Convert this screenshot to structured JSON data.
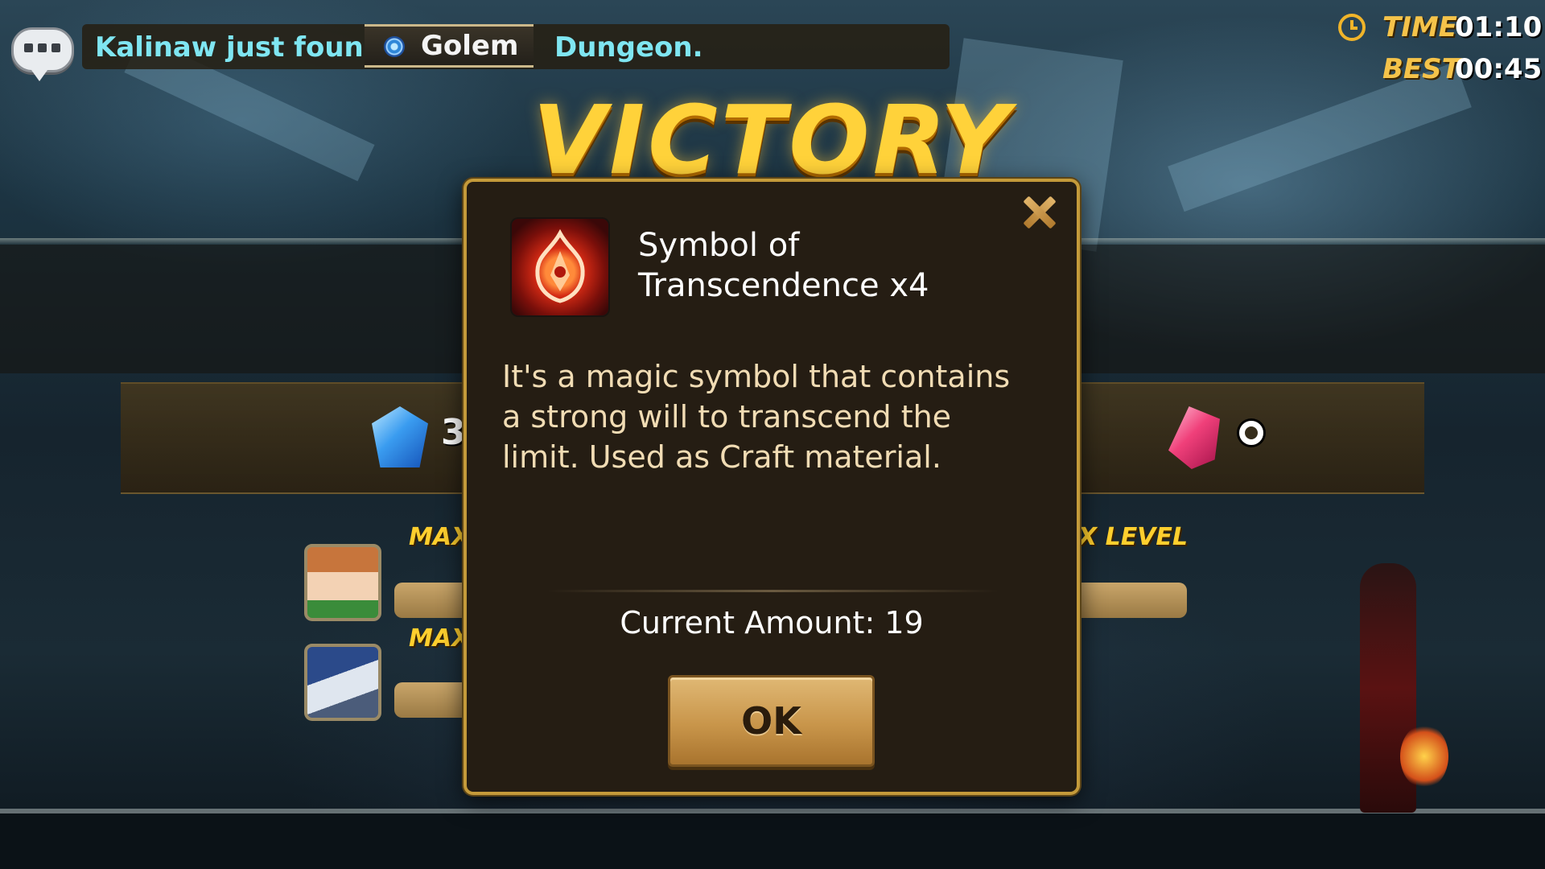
{
  "notice": {
    "prefix": "Kalinaw just found",
    "dungeon_name": "Golem",
    "suffix": "Dungeon."
  },
  "timer": {
    "time_label": "TIME",
    "time_value": "01:10",
    "best_label": "BEST",
    "best_value": "00:45"
  },
  "banner": {
    "title": "VICTORY"
  },
  "background_rewards": {
    "crystal_count_visible": "3",
    "max_label_left": "MAX",
    "max_level_right": "X LEVEL",
    "max_label_left_2": "MAX"
  },
  "modal": {
    "item_name": "Symbol of Transcendence x4",
    "description": "It's a magic symbol that contains a strong will to transcend the limit. Used as Craft material.",
    "amount_label": "Current Amount: 19",
    "ok_label": "OK"
  },
  "icons": {
    "chat": "chat-bubble-icon",
    "dungeon": "golem-swirl-icon",
    "clock": "alarm-clock-icon",
    "close": "close-x-icon",
    "item": "symbol-of-transcendence-icon",
    "blue_crystal": "blue-crystal-icon",
    "pink_crystal": "pink-crystal-icon"
  },
  "colors": {
    "notice_text": "#7fe6f2",
    "victory_gold": "#ffd23a",
    "modal_border": "#c49a3a",
    "modal_bg": "#251d13",
    "ok_button": "#c8954a"
  }
}
